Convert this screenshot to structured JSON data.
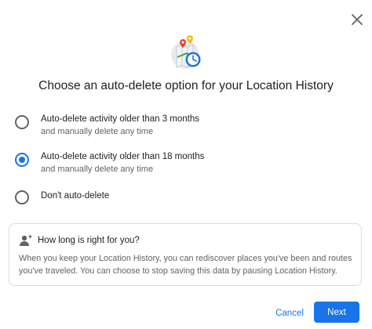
{
  "dialog": {
    "title": "Choose an auto-delete option for your Location History",
    "close_icon": "close-icon",
    "illustration_icon": "map-clock-illustration"
  },
  "options": [
    {
      "label": "Auto-delete activity older than 3 months",
      "sublabel": "and manually delete any time",
      "selected": false
    },
    {
      "label": "Auto-delete activity older than 18 months",
      "sublabel": "and manually delete any time",
      "selected": true
    },
    {
      "label": "Don't auto-delete",
      "selected": false
    }
  ],
  "info": {
    "icon": "person-sparkle-icon",
    "title": "How long is right for you?",
    "body": "When you keep your Location History, you can rediscover places you've been and routes you've traveled. You can choose to stop saving this data by pausing Location History."
  },
  "actions": {
    "cancel_label": "Cancel",
    "next_label": "Next"
  },
  "colors": {
    "accent": "#1a73e8",
    "text_primary": "#202124",
    "text_secondary": "#5f6368",
    "border": "#dadce0"
  }
}
